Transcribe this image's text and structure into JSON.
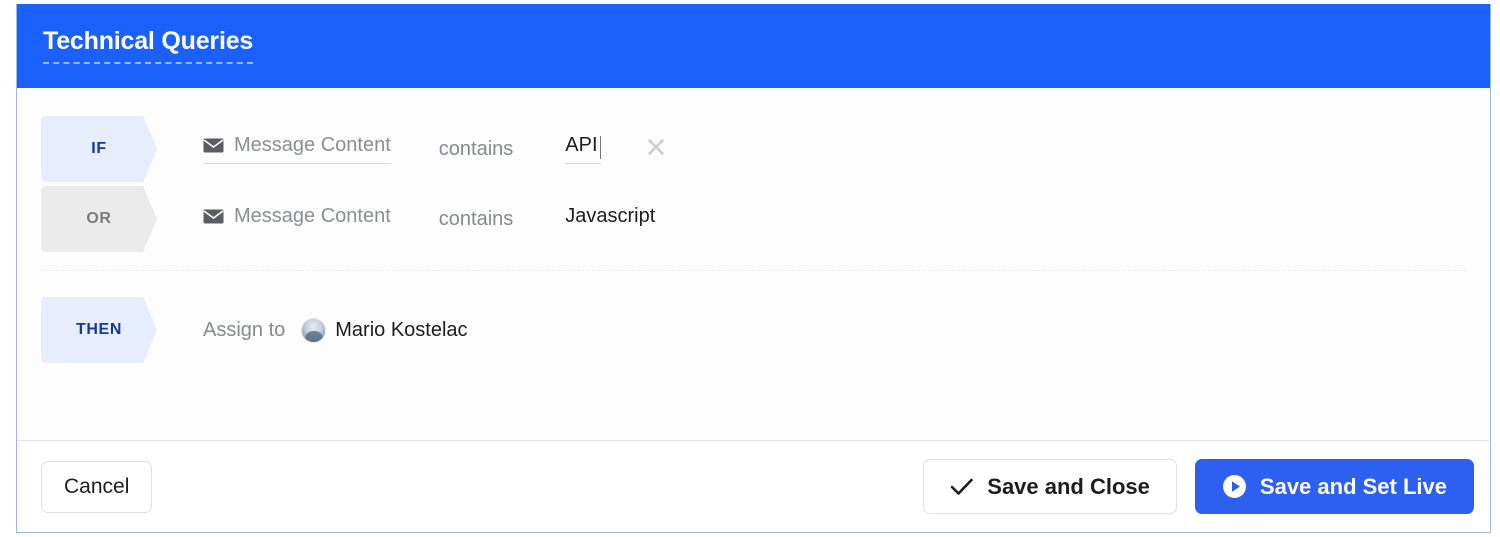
{
  "header": {
    "title": "Technical Queries"
  },
  "conditions": [
    {
      "connector": "IF",
      "attribute_icon": "envelope-icon",
      "attribute": "Message Content",
      "operator": "contains",
      "value": "API",
      "has_caret": true,
      "underlined": true,
      "remove_icon": "close-icon",
      "has_remove": true
    },
    {
      "connector": "OR",
      "attribute_icon": "envelope-icon",
      "attribute": "Message Content",
      "operator": "contains",
      "value": "Javascript",
      "has_caret": false,
      "underlined": false,
      "has_remove": false
    }
  ],
  "action": {
    "connector": "THEN",
    "label": "Assign to",
    "assignee": "Mario Kostelac",
    "avatar_icon": "user-avatar"
  },
  "footer": {
    "cancel_label": "Cancel",
    "save_close_label": "Save and Close",
    "save_close_icon": "check-icon",
    "save_live_label": "Save and Set Live",
    "save_live_icon": "play-circle-icon"
  },
  "colors": {
    "header_blue": "#1c60fb",
    "primary_button_blue": "#2d5ff0",
    "if_pill_bg": "#e8edfd",
    "if_pill_text": "#12399c",
    "or_pill_bg": "#ebebeb",
    "or_pill_text": "#7a7a7a"
  }
}
